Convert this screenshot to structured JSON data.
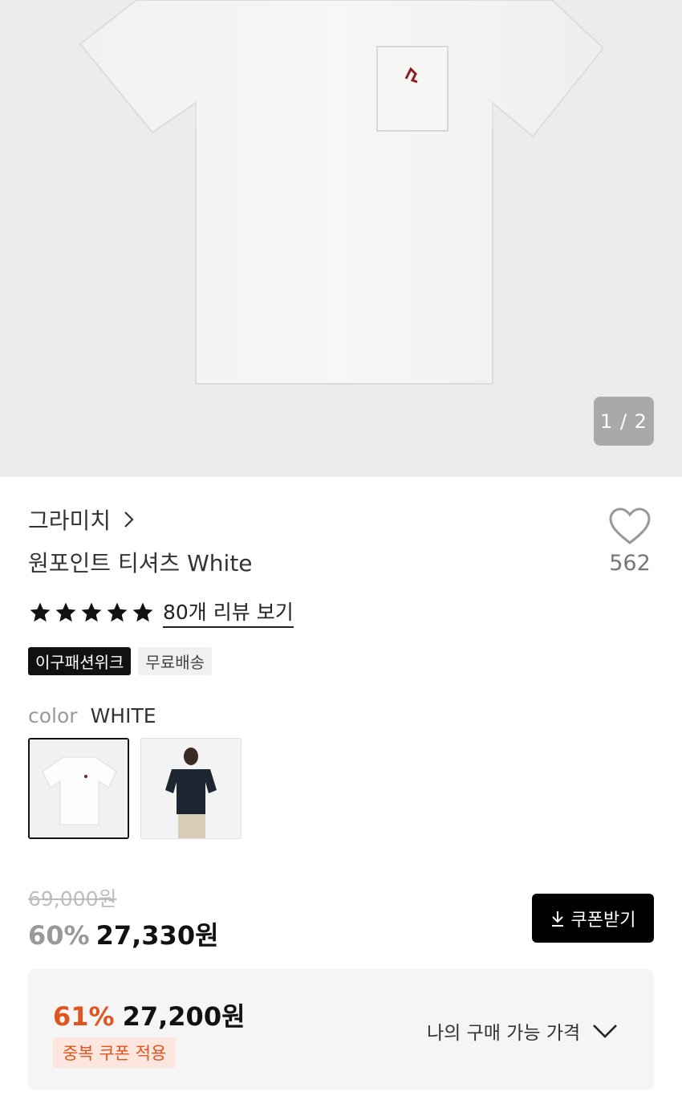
{
  "gallery": {
    "pager": "1 / 2"
  },
  "product": {
    "brand": "그라미치",
    "title": "원포인트 티셔츠 White",
    "like_count": "562",
    "rating_stars": 5,
    "review_link": "80개 리뷰 보기"
  },
  "badges": [
    "이구패션위크",
    "무료배송"
  ],
  "color": {
    "label": "color",
    "value": "WHITE"
  },
  "price": {
    "original": "69,000원",
    "discount_pct": "60%",
    "sale": "27,330원",
    "coupon_button": "쿠폰받기"
  },
  "best_price": {
    "discount_pct": "61%",
    "price": "27,200원",
    "tag": "중복 쿠폰 적용",
    "my_price_label": "나의 구매 가능 가격"
  },
  "colors": {
    "accent": "#e0541f",
    "dark": "#111111"
  }
}
